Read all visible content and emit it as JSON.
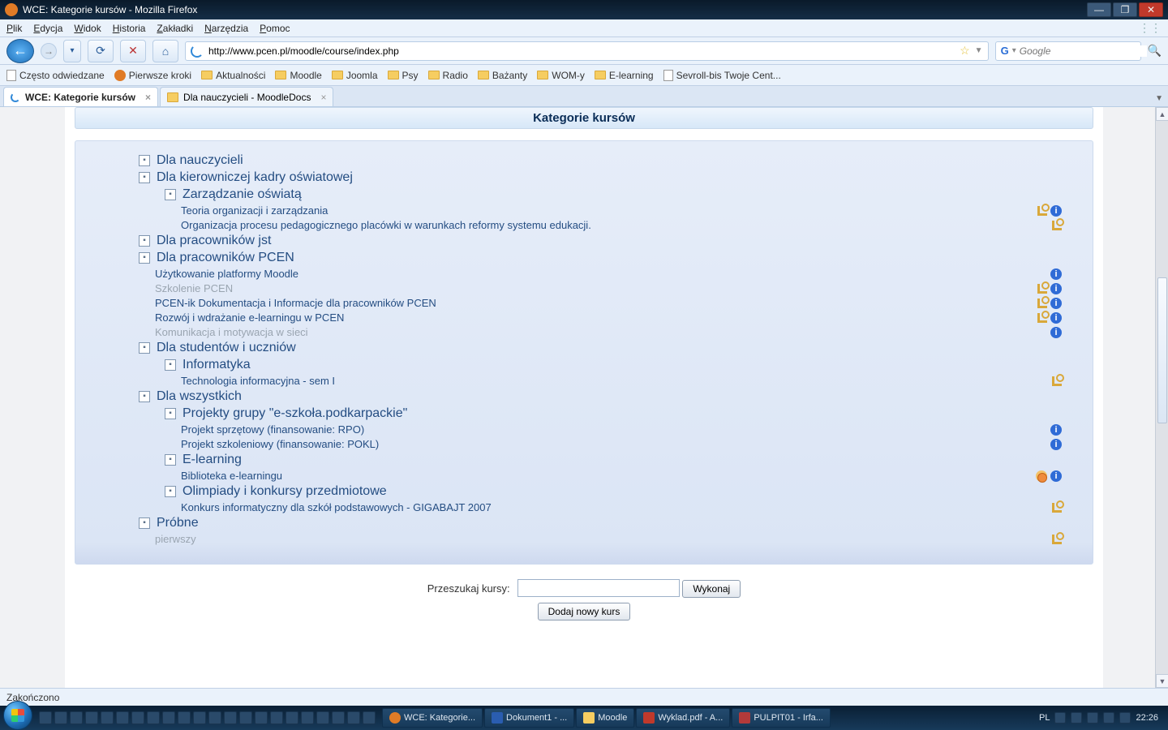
{
  "window": {
    "title": "WCE: Kategorie kursów - Mozilla Firefox"
  },
  "menu": [
    "Plik",
    "Edycja",
    "Widok",
    "Historia",
    "Zakładki",
    "Narzędzia",
    "Pomoc"
  ],
  "url": "http://www.pcen.pl/moodle/course/index.php",
  "search_placeholder": "Google",
  "bookmarks": [
    {
      "icon": "page",
      "label": "Często odwiedzane"
    },
    {
      "icon": "ff",
      "label": "Pierwsze kroki"
    },
    {
      "icon": "fold",
      "label": "Aktualności"
    },
    {
      "icon": "fold",
      "label": "Moodle"
    },
    {
      "icon": "fold",
      "label": "Joomla"
    },
    {
      "icon": "fold",
      "label": "Psy"
    },
    {
      "icon": "fold",
      "label": "Radio"
    },
    {
      "icon": "fold",
      "label": "Bażanty"
    },
    {
      "icon": "fold",
      "label": "WOM-y"
    },
    {
      "icon": "fold",
      "label": "E-learning"
    },
    {
      "icon": "page",
      "label": "Sevroll-bis Twoje Cent..."
    }
  ],
  "tabs": [
    {
      "label": "WCE: Kategorie kursów",
      "active": true,
      "icon": "spin"
    },
    {
      "label": "Dla nauczycieli - MoodleDocs",
      "active": false,
      "icon": "md"
    }
  ],
  "page_title": "Kategorie kursów",
  "tree": [
    {
      "t": "cat",
      "lvl": 1,
      "label": "Dla nauczycieli"
    },
    {
      "t": "cat",
      "lvl": 1,
      "label": "Dla kierowniczej kadry oświatowej"
    },
    {
      "t": "cat",
      "lvl": 2,
      "label": "Zarządzanie oświatą"
    },
    {
      "t": "course",
      "lvl": 3,
      "label": "Teoria organizacji i zarządzania",
      "icons": [
        "key",
        "info"
      ]
    },
    {
      "t": "course",
      "lvl": 3,
      "label": "Organizacja procesu pedagogicznego placówki w warunkach reformy systemu edukacji.",
      "icons": [
        "key"
      ]
    },
    {
      "t": "cat",
      "lvl": 1,
      "label": "Dla pracowników jst"
    },
    {
      "t": "cat",
      "lvl": 1,
      "label": "Dla pracowników PCEN"
    },
    {
      "t": "course",
      "lvl": 2,
      "label": "Użytkowanie platformy Moodle",
      "icons": [
        "info"
      ]
    },
    {
      "t": "course",
      "lvl": 2,
      "label": "Szkolenie PCEN",
      "dim": true,
      "icons": [
        "key",
        "info"
      ]
    },
    {
      "t": "course",
      "lvl": 2,
      "label": "PCEN-ik Dokumentacja i Informacje dla pracowników PCEN",
      "icons": [
        "key",
        "info"
      ]
    },
    {
      "t": "course",
      "lvl": 2,
      "label": "Rozwój i wdrażanie e-learningu w PCEN",
      "icons": [
        "key",
        "info"
      ]
    },
    {
      "t": "course",
      "lvl": 2,
      "label": "Komunikacja i motywacja w sieci",
      "dim": true,
      "icons": [
        "info"
      ]
    },
    {
      "t": "cat",
      "lvl": 1,
      "label": "Dla studentów i uczniów"
    },
    {
      "t": "cat",
      "lvl": 2,
      "label": "Informatyka"
    },
    {
      "t": "course",
      "lvl": 3,
      "label": "Technologia informacyjna - sem I",
      "icons": [
        "key"
      ]
    },
    {
      "t": "cat",
      "lvl": 1,
      "label": "Dla wszystkich"
    },
    {
      "t": "cat",
      "lvl": 2,
      "label": "Projekty grupy \"e-szkoła.podkarpackie\""
    },
    {
      "t": "course",
      "lvl": 3,
      "label": "Projekt sprzętowy (finansowanie: RPO)",
      "icons": [
        "info"
      ]
    },
    {
      "t": "course",
      "lvl": 3,
      "label": "Projekt szkoleniowy (finansowanie: POKL)",
      "icons": [
        "info"
      ]
    },
    {
      "t": "cat",
      "lvl": 2,
      "label": "E-learning"
    },
    {
      "t": "course",
      "lvl": 3,
      "label": "Biblioteka e-learningu",
      "icons": [
        "guest",
        "info"
      ]
    },
    {
      "t": "cat",
      "lvl": 2,
      "label": "Olimpiady i konkursy przedmiotowe"
    },
    {
      "t": "course",
      "lvl": 3,
      "label": "Konkurs informatyczny dla szkół podstawowych - GIGABAJT 2007",
      "icons": [
        "key"
      ]
    },
    {
      "t": "cat",
      "lvl": 1,
      "label": "Próbne"
    },
    {
      "t": "course",
      "lvl": 2,
      "label": "pierwszy",
      "dim": true,
      "icons": [
        "key"
      ]
    }
  ],
  "search_label": "Przeszukaj kursy:",
  "search_button": "Wykonaj",
  "add_button": "Dodaj nowy kurs",
  "status": "Zakończono",
  "taskbar": [
    {
      "cls": "ff",
      "label": "WCE: Kategorie..."
    },
    {
      "cls": "word",
      "label": "Dokument1 - ..."
    },
    {
      "cls": "moodle",
      "label": "Moodle"
    },
    {
      "cls": "pdf",
      "label": "Wyklad.pdf - A..."
    },
    {
      "cls": "paint",
      "label": "PULPIT01 - Irfa..."
    }
  ],
  "tray": {
    "lang": "PL",
    "clock": "22:26"
  }
}
